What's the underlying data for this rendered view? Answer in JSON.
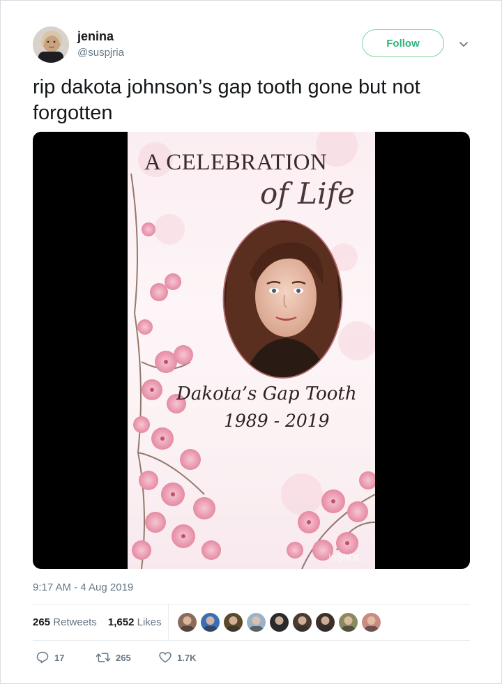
{
  "user": {
    "display_name": "jenina",
    "handle": "@suspjria"
  },
  "follow_label": "Follow",
  "tweet": {
    "text": "rip dakota johnson’s gap tooth gone but not forgotten"
  },
  "media": {
    "heading": "A CELEBRATION",
    "subheading": "of Life",
    "name_line": "Dakota’s Gap Tooth",
    "years": "1989 - 2019",
    "watermark": "InShOt"
  },
  "timestamp": "9:17 AM - 4 Aug 2019",
  "stats": {
    "retweets_count": "265",
    "retweets_label": "Retweets",
    "likes_count": "1,652",
    "likes_label": "Likes"
  },
  "likers": [
    {
      "color": "#8b6b5a"
    },
    {
      "color": "#3a6fb5"
    },
    {
      "color": "#5a4a2a"
    },
    {
      "color": "#9ab3c9"
    },
    {
      "color": "#2a2a2a"
    },
    {
      "color": "#4a3a30"
    },
    {
      "color": "#3d2f2a"
    },
    {
      "color": "#8a8a60"
    },
    {
      "color": "#c98a80"
    }
  ],
  "actions": {
    "reply_count": "17",
    "retweet_count": "265",
    "like_count": "1.7K"
  },
  "colors": {
    "accent_green": "#2fb57a",
    "text_primary": "#14171a",
    "text_secondary": "#657786"
  }
}
